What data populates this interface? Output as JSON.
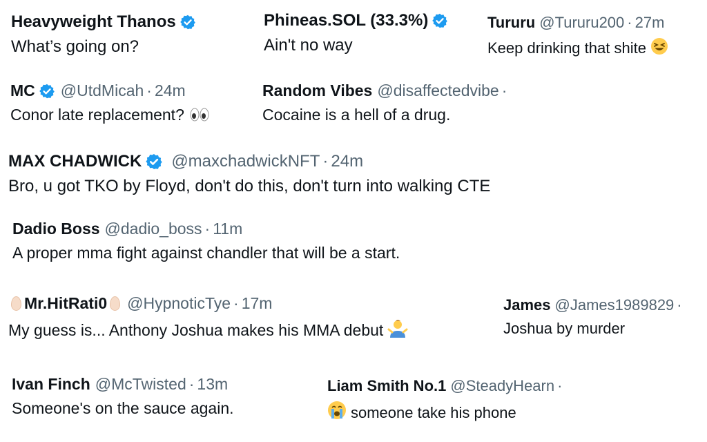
{
  "replies": [
    {
      "name": "Heavyweight Thanos",
      "verified": true,
      "handle": "",
      "time": "",
      "text": "What’s going on?"
    },
    {
      "name": "Phineas.SOL (33.3%)",
      "verified": true,
      "handle": "",
      "time": "",
      "text": "Ain't no way"
    },
    {
      "name": "Tururu",
      "verified": false,
      "handle": "@Tururu200",
      "time": "27m",
      "text": "Keep drinking that shite",
      "emoji": "laughing-face"
    },
    {
      "name": "MC",
      "verified": true,
      "handle": "@UtdMicah",
      "time": "24m",
      "text": "Conor late replacement?",
      "emoji": "eyes"
    },
    {
      "name": "Random Vibes",
      "verified": false,
      "handle": "@disaffectedvibe",
      "time": "",
      "text": "Cocaine is a hell of a drug."
    },
    {
      "name": "MAX CHADWICK",
      "verified": true,
      "handle": "@maxchadwickNFT",
      "time": "24m",
      "text": "Bro, u got TKO by Floyd, don't do this, don't turn into walking CTE"
    },
    {
      "name": "Dadio Boss",
      "verified": false,
      "handle": "@dadio_boss",
      "time": "11m",
      "text": "A proper mma fight against chandler that will be a start."
    },
    {
      "name": "Mr.HitRati0",
      "verified": false,
      "handle": "@HypnoticTye",
      "time": "17m",
      "text": "My guess is... Anthony Joshua makes his MMA debut",
      "emoji": "man-shrugging"
    },
    {
      "name": "James",
      "verified": false,
      "handle": "@James1989829",
      "time": "",
      "text": "Joshua by murder"
    },
    {
      "name": "Ivan Finch",
      "verified": false,
      "handle": "@McTwisted",
      "time": "13m",
      "text": "Someone's on the sauce again."
    },
    {
      "name": "Liam Smith No.1",
      "verified": false,
      "handle": "@SteadyHearn",
      "time": "",
      "text": "someone take his phone",
      "emoji": "crying-face"
    }
  ],
  "colors": {
    "text": "#0f1419",
    "secondary": "#536471",
    "verified": "#1d9bf0"
  },
  "separator": "·"
}
